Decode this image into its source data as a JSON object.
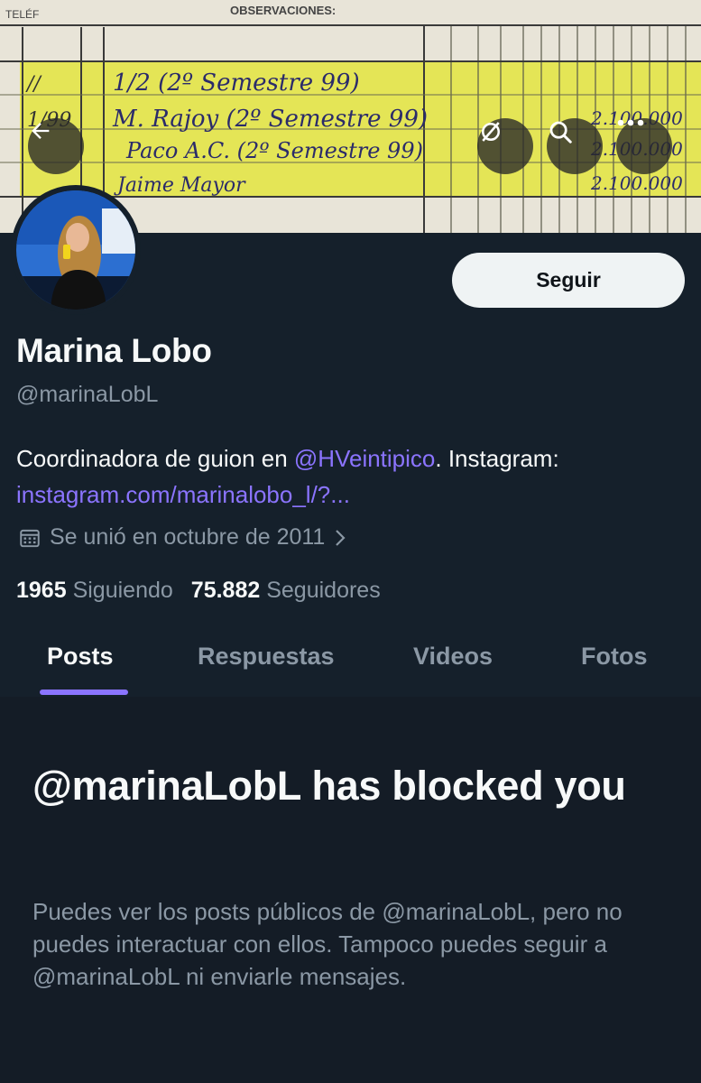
{
  "header": {
    "back_icon": "arrow-left-icon",
    "icons": [
      "eye-off-icon",
      "search-icon",
      "more-icon"
    ]
  },
  "banner": {
    "header_left": "TELÉF",
    "header_obs": "OBSERVACIONES:",
    "rows": [
      "1/2  (2º Semestre 99)",
      "M. Rajoy (2º Semestre 99)",
      "Paco A.C. (2º Semestre 99)",
      "Jaime Mayor"
    ],
    "amounts": [
      "2.100.000",
      "2.100.000",
      "2.100.000"
    ]
  },
  "profile": {
    "name": "Marina Lobo",
    "handle": "@marinaLobL",
    "follow_label": "Seguir",
    "bio_prefix": "Coordinadora de guion en ",
    "bio_mention": "@HVeintipico",
    "bio_suffix": ". Instagram:",
    "bio_link": "instagram.com/marinalobo_l/?...",
    "joined": "Se unió en octubre de 2011",
    "following_count": "1965",
    "following_label": "Siguiendo",
    "followers_count": "75.882",
    "followers_label": "Seguidores"
  },
  "tabs": [
    "Posts",
    "Respuestas",
    "Videos",
    "Fotos"
  ],
  "blocked": {
    "title": "@marinaLobL has blocked you",
    "message": "Puedes ver los posts públicos de @marinaLobL, pero no puedes interactuar con ellos. Tampoco puedes seguir a @marinaLobL ni enviarle mensajes."
  },
  "colors": {
    "background": "#15202b",
    "accent": "#8b74ff",
    "secondary_text": "#8b98a5"
  }
}
